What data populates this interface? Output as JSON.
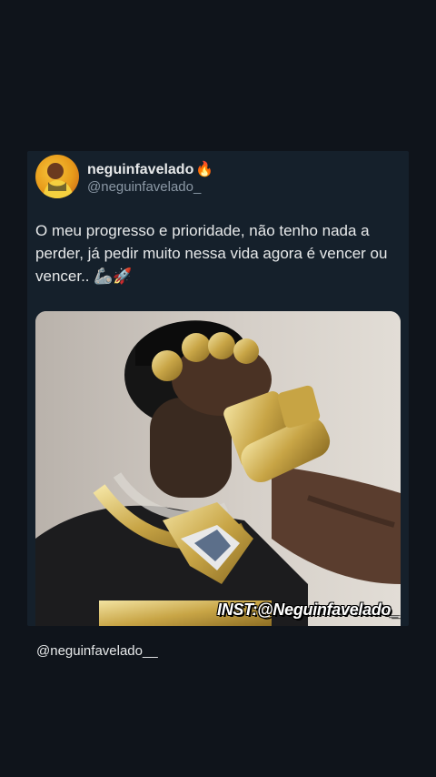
{
  "tweet": {
    "display_name": "neguinfavelado",
    "name_emoji": "🔥",
    "handle": "@neguinfavelado_",
    "text": "O meu progresso e prioridade, não tenho nada a perder, já pedir muito nessa vida agora é vencer ou vencer.. 🦾🚀",
    "media": {
      "watermark": "INST:@Neguinfavelado_"
    }
  },
  "caption": "@neguinfavelado__",
  "colors": {
    "background": "#0f141b",
    "card": "#15202b",
    "text": "#e7e9ea",
    "muted": "#8b98a5"
  }
}
